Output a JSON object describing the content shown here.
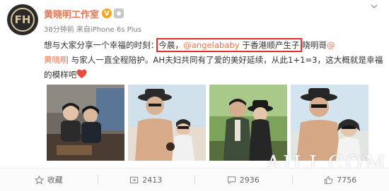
{
  "post": {
    "avatar_text": "FH",
    "author": "黄晓明工作室",
    "verified_mark": "V",
    "meta": "38分钟前 来自iPhone 6s Plus",
    "text": {
      "line1_start": "想与大家分享一个幸福的时刻：",
      "highlight_plain": "今晨，",
      "highlight_mention": "@angelababy",
      "highlight_end": " 于香港顺产生子",
      "line1_after": " 晓明哥",
      "mention_at": "@",
      "mention_name": "黄晓明",
      "line2_rest": " 与家人一直全程陪护。AH夫妇共同有了爱的美好延续，从此1+1=3，这大概就是幸福的模样吧"
    },
    "watermark": "AILI.COM",
    "actions": {
      "favorite": "收藏",
      "repost_count": "2413",
      "comment_count": "2936",
      "like_count": "7756"
    }
  },
  "colors": {
    "author": "#eb7350",
    "link": "#eb7350",
    "highlight_box": "#e5302b",
    "verified": "#f5a623"
  }
}
